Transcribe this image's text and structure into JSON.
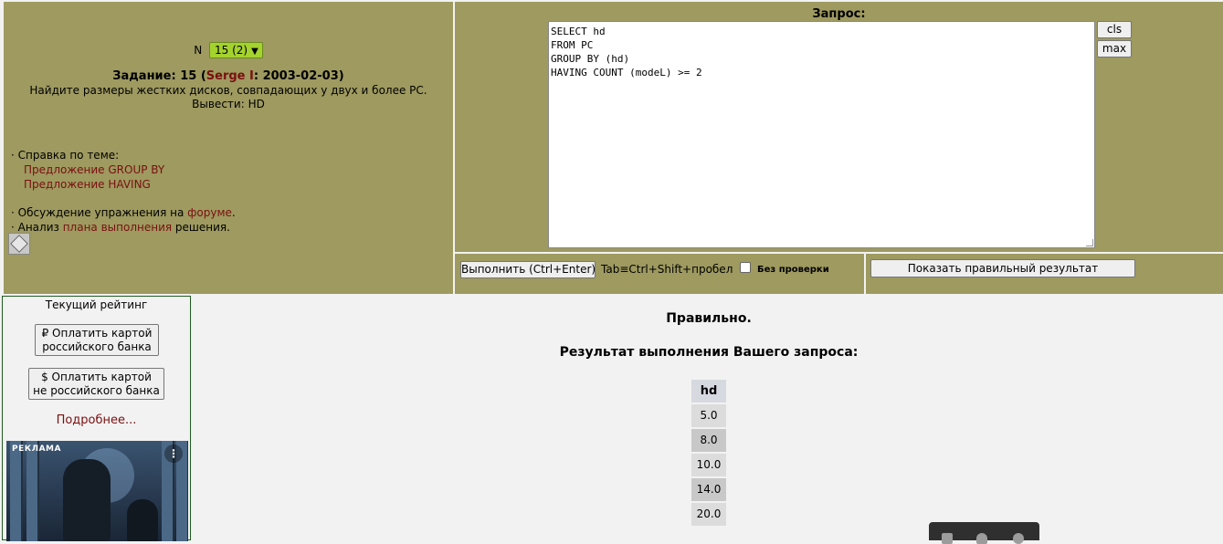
{
  "task": {
    "selector_prefix": "N",
    "selected_value": "15 (2)",
    "title_prefix": "Задание: 15 (",
    "author": "Serge I",
    "title_suffix": ": 2003-02-03)",
    "description": "Найдите размеры жестких дисков, совпадающих у двух и более PC.",
    "output_line": "Вывести: HD"
  },
  "help": {
    "heading": "· Справка по теме:",
    "links": [
      "Предложение GROUP BY",
      "Предложение HAVING"
    ],
    "forum_prefix": "· Обсуждение упражнения на ",
    "forum_link": "форуме",
    "forum_suffix": ".",
    "plan_prefix": "· Анализ ",
    "plan_link": "плана выполнения",
    "plan_suffix": " решения."
  },
  "query": {
    "label": "Запрос:",
    "sql": "SELECT hd\nFROM PC\nGROUP BY (hd)\nHAVING COUNT (modeL) >= 2",
    "cls_label": "cls",
    "max_label": "max"
  },
  "run": {
    "button_label": "Выполнить (Ctrl+Enter)",
    "tab_hint": "Tab≡Ctrl+Shift+пробел",
    "nocheck_label": "Без проверки",
    "show_result_label": "Показать правильный результат"
  },
  "rating": {
    "title": "Текущий рейтинг",
    "pay_ru_line1": "₽ Оплатить картой",
    "pay_ru_line2": "российского банка",
    "pay_foreign_line1": "$ Оплатить картой",
    "pay_foreign_line2": "не российского банка",
    "more": "Подробнее...",
    "ad_label": "РЕКЛАМА",
    "ad_menu_icon": "⋮"
  },
  "result": {
    "status": "Правильно.",
    "heading": "Результат выполнения Вашего запроса:",
    "columns": [
      "hd"
    ],
    "rows": [
      "5.0",
      "8.0",
      "10.0",
      "14.0",
      "20.0"
    ]
  },
  "colors": {
    "panel_olive": "#9e9a60",
    "link_red": "#7a1010",
    "select_green": "#a4d22e"
  }
}
